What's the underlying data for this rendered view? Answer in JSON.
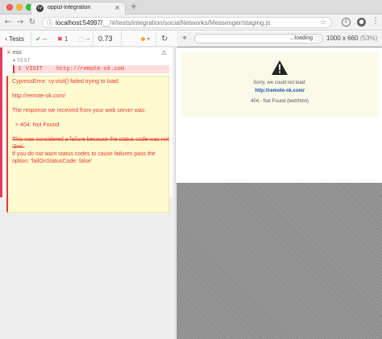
{
  "browser": {
    "tab_title": "oppizi-integration",
    "tab_favicon": "cypress-favicon",
    "url_host": "localhost:54997/",
    "url_path": "__/#/tests/integration/socialNetworks/Messenger/staging.js"
  },
  "reporter": {
    "tests_label": "Tests",
    "passed": "--",
    "failed": "1",
    "pending": "--",
    "duration": "0.73",
    "suite_title": "ess",
    "test_label": "TEST",
    "command": {
      "number": "1",
      "name": "VISIT",
      "message": "http://remote-ok.com"
    },
    "error_lines": [
      "CypressError: cy.visit() failed trying to load:",
      "http://remote-ok.com/",
      "The response we received from your web server was:",
      "> 404: Not Found",
      "This was considered a failure because the status code was not '2xx'.",
      "If you do not want status codes to cause failures pass the option: 'failOnStatusCode: false'"
    ]
  },
  "aut": {
    "url_status": "...loading",
    "viewport_size": "1000 x 660",
    "viewport_scale": "(53%)",
    "page": {
      "message": "Sorry, we could not load:",
      "link": "http://remote-ok.com/",
      "status": "404 - Not Found (text/html)"
    }
  },
  "colors": {
    "fail": "#e53935",
    "pass": "#4caf50",
    "error_bg": "#fffbd0",
    "running": "#f5a623"
  }
}
